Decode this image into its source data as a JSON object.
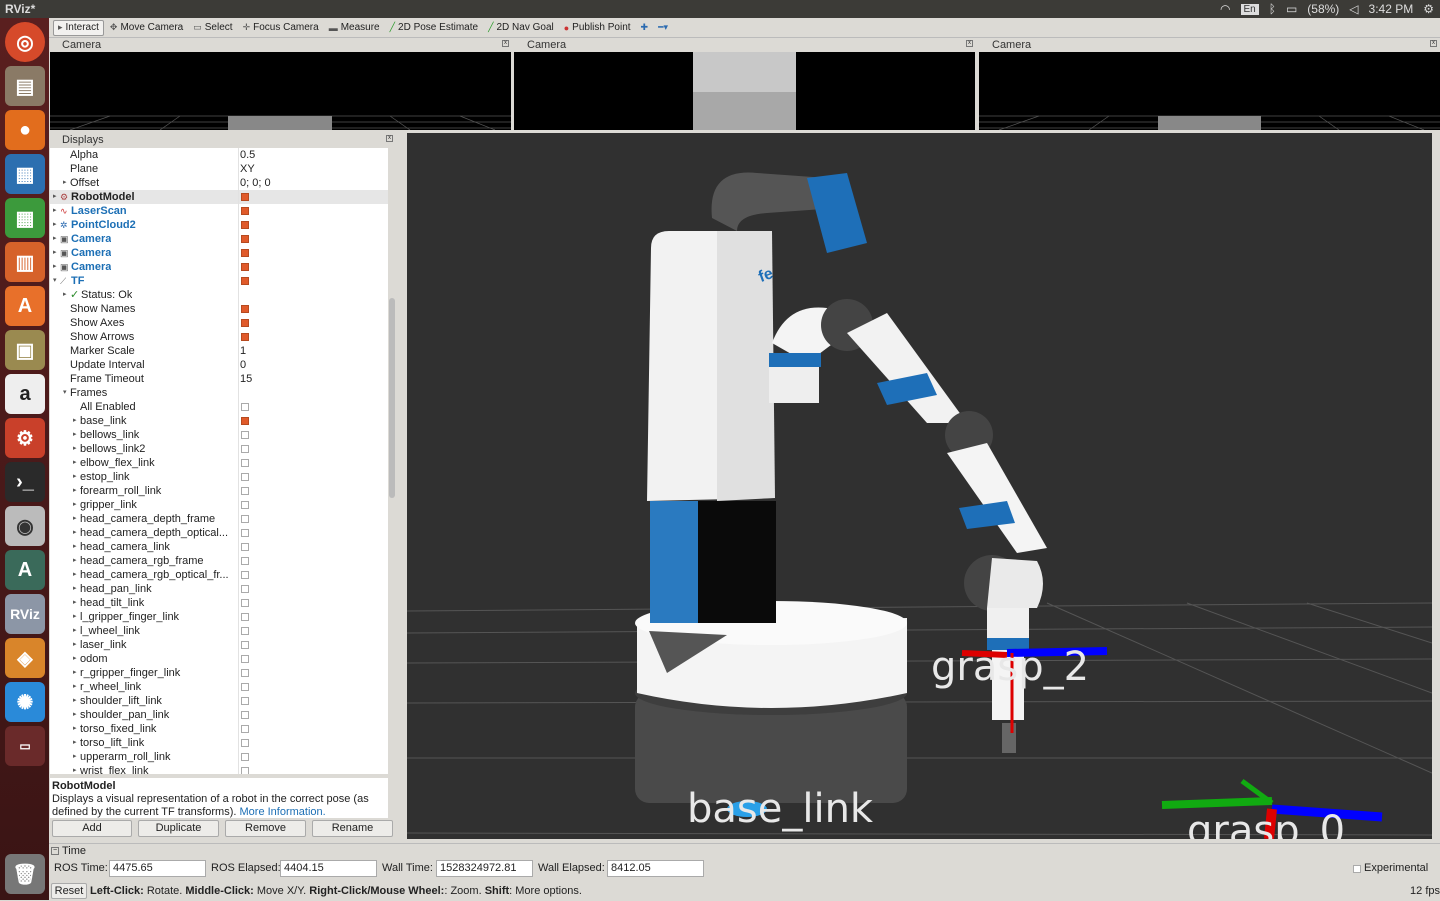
{
  "window": {
    "title": "RViz*"
  },
  "tray": {
    "keyboard": "En",
    "battery": "(58%)",
    "clock": "3:42 PM"
  },
  "toolbar": {
    "interact": "Interact",
    "move_camera": "Move Camera",
    "select": "Select",
    "focus_camera": "Focus Camera",
    "measure": "Measure",
    "pose_estimate": "2D Pose Estimate",
    "nav_goal": "2D Nav Goal",
    "publish_point": "Publish Point"
  },
  "camera_panels": [
    {
      "title": "Camera"
    },
    {
      "title": "Camera"
    },
    {
      "title": "Camera"
    }
  ],
  "displays": {
    "title": "Displays",
    "props": [
      {
        "name": "Alpha",
        "value": "0.5"
      },
      {
        "name": "Plane",
        "value": "XY"
      },
      {
        "name": "Offset",
        "value": "0; 0; 0"
      }
    ],
    "items": [
      {
        "name": "RobotModel",
        "checked": true
      },
      {
        "name": "LaserScan",
        "checked": true
      },
      {
        "name": "PointCloud2",
        "checked": true
      },
      {
        "name": "Camera",
        "checked": true
      },
      {
        "name": "Camera",
        "checked": true
      },
      {
        "name": "Camera",
        "checked": true
      },
      {
        "name": "TF",
        "checked": true
      }
    ],
    "tf_status": "Status: Ok",
    "tf_props": [
      {
        "name": "Show Names",
        "checked": true
      },
      {
        "name": "Show Axes",
        "checked": true
      },
      {
        "name": "Show Arrows",
        "checked": true
      }
    ],
    "tf_values": [
      {
        "name": "Marker Scale",
        "value": "1"
      },
      {
        "name": "Update Interval",
        "value": "0"
      },
      {
        "name": "Frame Timeout",
        "value": "15"
      }
    ],
    "frames_label": "Frames",
    "all_enabled": "All Enabled",
    "frames": [
      {
        "name": "base_link",
        "checked": true
      },
      {
        "name": "bellows_link",
        "checked": false
      },
      {
        "name": "bellows_link2",
        "checked": false
      },
      {
        "name": "elbow_flex_link",
        "checked": false
      },
      {
        "name": "estop_link",
        "checked": false
      },
      {
        "name": "forearm_roll_link",
        "checked": false
      },
      {
        "name": "gripper_link",
        "checked": false
      },
      {
        "name": "head_camera_depth_frame",
        "checked": false
      },
      {
        "name": "head_camera_depth_optical...",
        "checked": false
      },
      {
        "name": "head_camera_link",
        "checked": false
      },
      {
        "name": "head_camera_rgb_frame",
        "checked": false
      },
      {
        "name": "head_camera_rgb_optical_fr...",
        "checked": false
      },
      {
        "name": "head_pan_link",
        "checked": false
      },
      {
        "name": "head_tilt_link",
        "checked": false
      },
      {
        "name": "l_gripper_finger_link",
        "checked": false
      },
      {
        "name": "l_wheel_link",
        "checked": false
      },
      {
        "name": "laser_link",
        "checked": false
      },
      {
        "name": "odom",
        "checked": false
      },
      {
        "name": "r_gripper_finger_link",
        "checked": false
      },
      {
        "name": "r_wheel_link",
        "checked": false
      },
      {
        "name": "shoulder_lift_link",
        "checked": false
      },
      {
        "name": "shoulder_pan_link",
        "checked": false
      },
      {
        "name": "torso_fixed_link",
        "checked": false
      },
      {
        "name": "torso_lift_link",
        "checked": false
      },
      {
        "name": "upperarm_roll_link",
        "checked": false
      },
      {
        "name": "wrist_flex_link",
        "checked": false
      }
    ]
  },
  "description": {
    "heading": "RobotModel",
    "text": "Displays a visual representation of a robot in the correct pose (as defined by the current TF transforms).",
    "link": "More Information."
  },
  "buttons": {
    "add": "Add",
    "duplicate": "Duplicate",
    "remove": "Remove",
    "rename": "Rename"
  },
  "viewport": {
    "labels": {
      "grasp2": "grasp_2",
      "base": "base_link",
      "grasp0": "grasp_0"
    },
    "logo": "fe"
  },
  "time": {
    "title": "Time",
    "ros_time_label": "ROS Time:",
    "ros_time": "4475.65",
    "ros_elapsed_label": "ROS Elapsed:",
    "ros_elapsed": "4404.15",
    "wall_time_label": "Wall Time:",
    "wall_time": "1528324972.81",
    "wall_elapsed_label": "Wall Elapsed:",
    "wall_elapsed": "8412.05",
    "experimental": "Experimental"
  },
  "status": {
    "reset": "Reset",
    "left_click": "Left-Click:",
    "left_click_desc": "Rotate.",
    "middle_click": "Middle-Click:",
    "middle_click_desc": "Move X/Y.",
    "right_click": "Right-Click/Mouse Wheel:",
    "right_click_desc": ": Zoom.",
    "shift": "Shift",
    "shift_desc": ": More options.",
    "fps": "12 fps"
  }
}
